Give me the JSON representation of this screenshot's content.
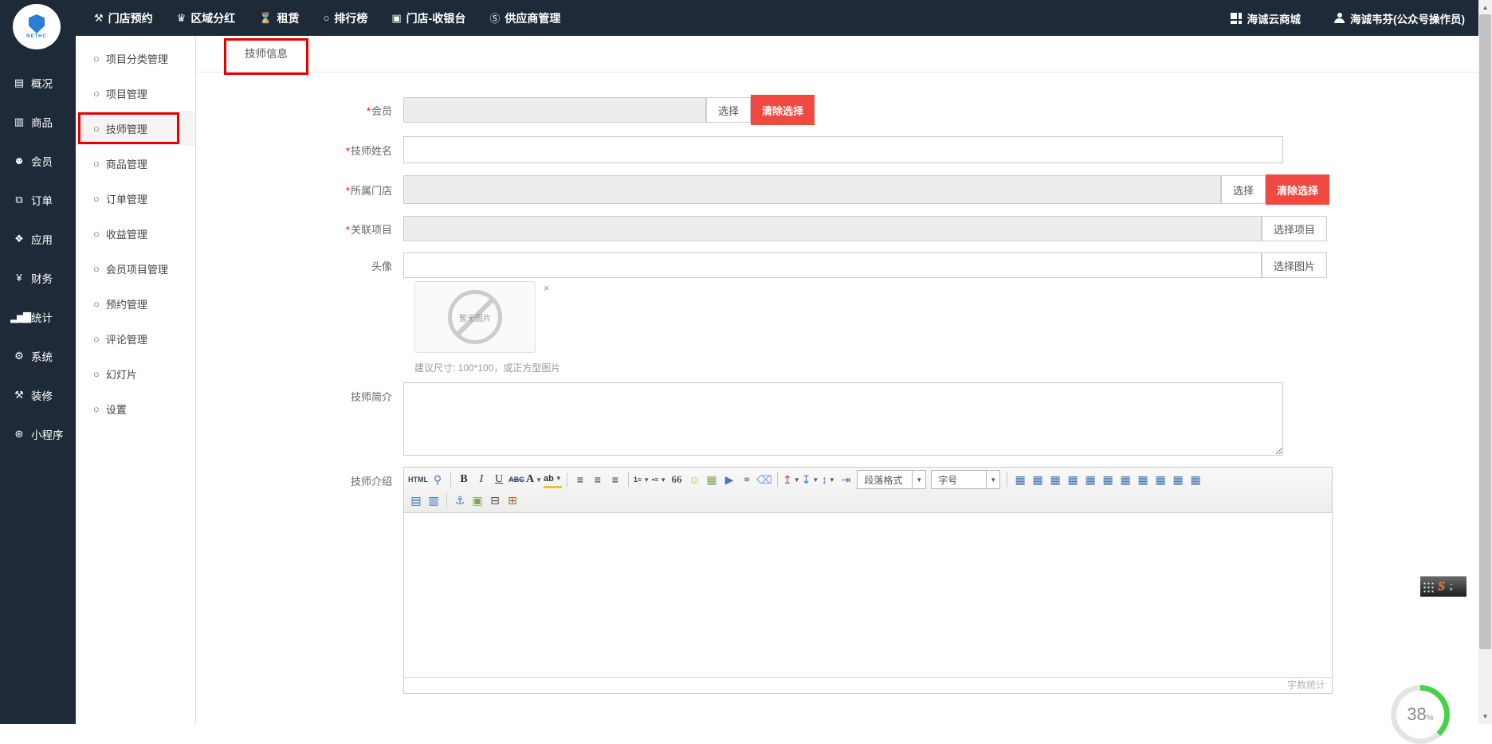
{
  "topbar": {
    "nav": [
      {
        "icon": "wrench-icon",
        "glyph": "⚒",
        "label": "门店预约"
      },
      {
        "icon": "trophy-icon",
        "glyph": "♛",
        "label": "区域分红"
      },
      {
        "icon": "hourglass-icon",
        "glyph": "⌛",
        "label": "租赁"
      },
      {
        "icon": "circle-icon",
        "glyph": "○",
        "label": "排行榜"
      },
      {
        "icon": "cashier-icon",
        "glyph": "▣",
        "label": "门店-收银台"
      },
      {
        "icon": "supplier-icon",
        "glyph": "Ⓢ",
        "label": "供应商管理"
      }
    ],
    "mall_label": "海诚云商城",
    "user_label": "海诚韦芬(公众号操作员)"
  },
  "logo": {
    "text": "NETHC"
  },
  "sidebar": {
    "items": [
      {
        "icon": "overview-icon",
        "glyph": "▤",
        "label": "概况"
      },
      {
        "icon": "goods-icon",
        "glyph": "▥",
        "label": "商品"
      },
      {
        "icon": "members-icon",
        "glyph": "☻",
        "label": "会员"
      },
      {
        "icon": "orders-icon",
        "glyph": "⧉",
        "label": "订单"
      },
      {
        "icon": "apps-icon",
        "glyph": "❖",
        "label": "应用"
      },
      {
        "icon": "finance-icon",
        "glyph": "¥",
        "label": "财务"
      },
      {
        "icon": "stats-icon",
        "glyph": "▂▅▇",
        "label": "统计"
      },
      {
        "icon": "system-icon",
        "glyph": "⚙",
        "label": "系统"
      },
      {
        "icon": "decorate-icon",
        "glyph": "⚒",
        "label": "装修"
      },
      {
        "icon": "miniprogram-icon",
        "glyph": "⊛",
        "label": "小程序"
      }
    ]
  },
  "submenu": {
    "items": [
      "项目分类管理",
      "项目管理",
      "技师管理",
      "商品管理",
      "订单管理",
      "收益管理",
      "会员项目管理",
      "预约管理",
      "评论管理",
      "幻灯片",
      "设置"
    ],
    "active_index": 2
  },
  "tab": {
    "label": "技师信息"
  },
  "form": {
    "member": {
      "required": "*",
      "label": "会员",
      "select": "选择",
      "clear": "清除选择"
    },
    "name": {
      "required": "*",
      "label": "技师姓名"
    },
    "store": {
      "required": "*",
      "label": "所属门店",
      "select": "选择",
      "clear": "清除选择"
    },
    "project": {
      "required": "*",
      "label": "关联项目",
      "select": "选择项目"
    },
    "avatar": {
      "label": "头像",
      "select": "选择图片",
      "no_image": "暂无图片",
      "remove": "×",
      "hint": "建议尺寸: 100*100，或正方型图片"
    },
    "intro": {
      "label": "技师简介"
    },
    "desc": {
      "label": "技师介绍"
    }
  },
  "editor": {
    "toolbar_row1": [
      {
        "t": "icon",
        "n": "html-source-icon",
        "g": "HTML",
        "k": "txt"
      },
      {
        "t": "icon",
        "n": "preview-icon",
        "g": "⚲",
        "c": "#4a78b8"
      },
      {
        "t": "sep"
      },
      {
        "t": "icon",
        "n": "bold-icon",
        "g": "B",
        "k": "bold"
      },
      {
        "t": "icon",
        "n": "italic-icon",
        "g": "I",
        "k": "ital"
      },
      {
        "t": "icon",
        "n": "underline-icon",
        "g": "U",
        "k": "und"
      },
      {
        "t": "icon",
        "n": "strikethrough-icon",
        "g": "ABC",
        "k": "txt strike"
      },
      {
        "t": "icon",
        "n": "font-color-icon",
        "g": "A",
        "k": "bold",
        "caret": 1
      },
      {
        "t": "icon",
        "n": "highlight-color-icon",
        "g": "ab",
        "k": "hilite",
        "caret": 1
      },
      {
        "t": "sep"
      },
      {
        "t": "icon",
        "n": "align-left-icon",
        "g": "≡"
      },
      {
        "t": "icon",
        "n": "align-center-icon",
        "g": "≡"
      },
      {
        "t": "icon",
        "n": "align-right-icon",
        "g": "≡"
      },
      {
        "t": "sep"
      },
      {
        "t": "icon",
        "n": "ordered-list-icon",
        "g": "1≡",
        "k": "txt",
        "caret": 1
      },
      {
        "t": "icon",
        "n": "unordered-list-icon",
        "g": "•≡",
        "k": "txt",
        "caret": 1
      },
      {
        "t": "icon",
        "n": "blockquote-icon",
        "g": "66",
        "k": "quote"
      },
      {
        "t": "icon",
        "n": "emoticon-icon",
        "g": "☺",
        "c": "#e8a33d"
      },
      {
        "t": "icon",
        "n": "insert-image-icon",
        "g": "▦",
        "c": "#7fa35a"
      },
      {
        "t": "icon",
        "n": "insert-media-icon",
        "g": "▶",
        "c": "#4a78b8"
      },
      {
        "t": "icon",
        "n": "hyperlink-icon",
        "g": "⚭",
        "c": "#888888"
      },
      {
        "t": "icon",
        "n": "remove-format-icon",
        "g": "⌫",
        "c": "#7a9ecf"
      },
      {
        "t": "sep"
      },
      {
        "t": "icon",
        "n": "margin-top-icon",
        "g": "↥",
        "c": "#c04040",
        "caret": 1
      },
      {
        "t": "icon",
        "n": "margin-bottom-icon",
        "g": "↧",
        "c": "#4a78b8",
        "caret": 1
      },
      {
        "t": "icon",
        "n": "line-height-icon",
        "g": "↕",
        "c": "#4a78b8",
        "caret": 1
      },
      {
        "t": "icon",
        "n": "indent-icon",
        "g": "⇥",
        "c": "#4a78b8"
      },
      {
        "t": "select",
        "n": "paragraph-format-select",
        "label": "段落格式"
      },
      {
        "t": "select",
        "n": "font-size-select",
        "label": "字号"
      },
      {
        "t": "sep"
      },
      {
        "t": "icon",
        "n": "insert-table-icon",
        "g": "▦",
        "c": "#3f6fae"
      },
      {
        "t": "icon",
        "n": "delete-table-icon",
        "g": "▦",
        "c": "#3f6fae"
      },
      {
        "t": "icon",
        "n": "table-prop-icon",
        "g": "▦",
        "c": "#3f6fae"
      },
      {
        "t": "icon",
        "n": "insert-row-above-icon",
        "g": "▦",
        "c": "#3f6fae"
      },
      {
        "t": "icon",
        "n": "insert-col-left-icon",
        "g": "▦",
        "c": "#3f6fae"
      },
      {
        "t": "icon",
        "n": "insert-col-right-icon",
        "g": "▦",
        "c": "#3f6fae"
      },
      {
        "t": "icon",
        "n": "delete-row-icon",
        "g": "▦",
        "c": "#3f6fae"
      },
      {
        "t": "icon",
        "n": "delete-col-icon",
        "g": "▦",
        "c": "#3f6fae"
      },
      {
        "t": "icon",
        "n": "select-table-icon",
        "g": "▦",
        "c": "#3f6fae"
      },
      {
        "t": "icon",
        "n": "merge-cells-icon",
        "g": "▦",
        "c": "#3f6fae"
      },
      {
        "t": "icon",
        "n": "split-cells-icon",
        "g": "▦",
        "c": "#3f6fae"
      }
    ],
    "toolbar_row2": [
      {
        "t": "icon",
        "n": "rowspan-icon",
        "g": "▤",
        "c": "#3f6fae"
      },
      {
        "t": "icon",
        "n": "colspan-icon",
        "g": "▥",
        "c": "#3f6fae"
      },
      {
        "t": "sep"
      },
      {
        "t": "icon",
        "n": "anchor-icon",
        "g": "⚓",
        "c": "#4a78b8"
      },
      {
        "t": "icon",
        "n": "image-map-icon",
        "g": "▣",
        "c": "#7fa35a"
      },
      {
        "t": "icon",
        "n": "print-icon",
        "g": "⊟",
        "c": "#555555"
      },
      {
        "t": "icon",
        "n": "paste-icon",
        "g": "⊞",
        "c": "#b5651d"
      }
    ],
    "status": "字数统计"
  },
  "widgets": {
    "progress_value": "38",
    "progress_unit": "%",
    "sogou_logo": "S"
  },
  "colors": {
    "dark": "#1e2a38",
    "accent_red": "#f04942",
    "annotation_red": "#e80000",
    "progress_green": "#4ad04a"
  }
}
